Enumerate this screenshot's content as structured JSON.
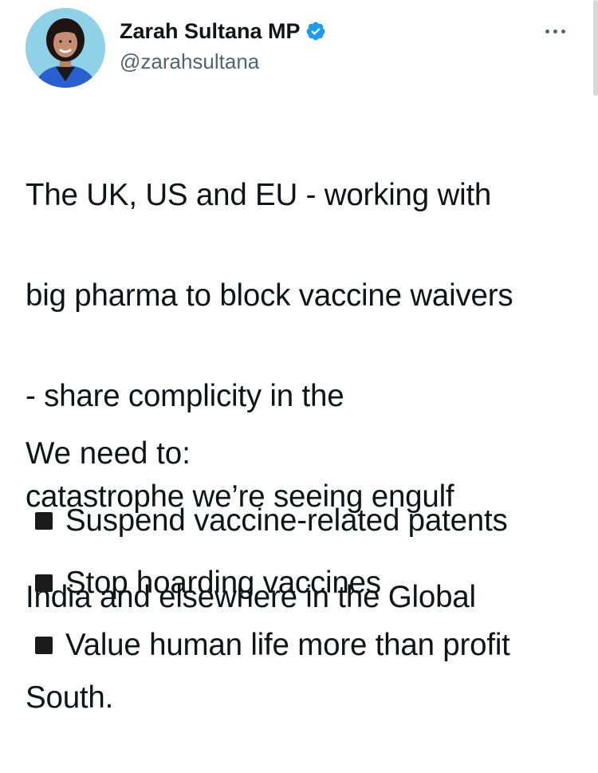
{
  "author": {
    "display_name": "Zarah Sultana MP",
    "handle": "@zarahsultana",
    "verified": true,
    "avatar_icon": "profile-photo"
  },
  "tweet": {
    "text_lines": [
      "The UK, US and EU - working with",
      "big pharma to block vaccine waivers",
      "- share complicity in the",
      "catastrophe we’re seeing engulf",
      "India and elsewhere in the Global",
      "South."
    ],
    "intro": "We need to:",
    "bullets": [
      "Suspend vaccine-related patents",
      "Stop hoarding vaccines",
      "Value human life more than profit"
    ]
  },
  "colors": {
    "text": "#0f1419",
    "secondary_text": "#536471",
    "verified_badge": "#1d9bf0"
  }
}
